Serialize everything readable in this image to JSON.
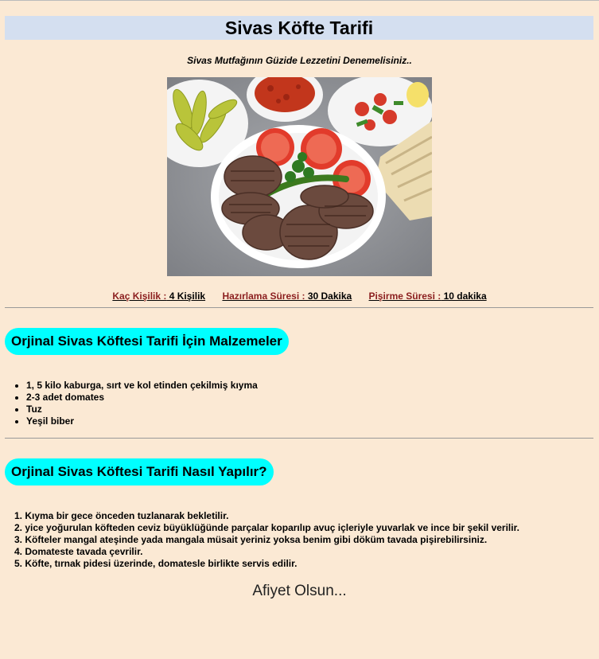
{
  "page": {
    "title": "Sivas Köfte Tarifi",
    "subtitle": "Sivas Mutfağının Güzide Lezzetini Denemelisiniz.."
  },
  "info": [
    {
      "label": "Kaç Kişilik :",
      "value": " 4 Kişilik"
    },
    {
      "label": "Hazırlama Süresi :",
      "value": " 30 Dakika"
    },
    {
      "label": "Pişirme Süresi :",
      "value": " 10 dakika"
    }
  ],
  "ingredients": {
    "heading": "Orjinal Sivas Köftesi Tarifi İçin Malzemeler",
    "items": [
      "1, 5 kilo kaburga, sırt ve kol etinden çekilmiş kıyma",
      "2-3 adet domates",
      "Tuz",
      "Yeşil biber"
    ]
  },
  "steps": {
    "heading": "Orjinal Sivas Köftesi Tarifi Nasıl Yapılır?",
    "items": [
      "1. Kıyma bir gece önceden tuzlanarak bekletilir.",
      "2. yice yoğurulan köfteden ceviz büyüklüğünde parçalar koparılıp avuç içleriyle yuvarlak ve ince bir şekil verilir.",
      "3. Köfteler mangal ateşinde yada mangala müsait yeriniz yoksa benim gibi döküm tavada pişirebilirsiniz.",
      "4. Domateste tavada çevrilir.",
      "5. Köfte, tırnak pidesi üzerinde, domatesle birlikte servis edilir."
    ]
  },
  "closing": "Afiyet Olsun..."
}
